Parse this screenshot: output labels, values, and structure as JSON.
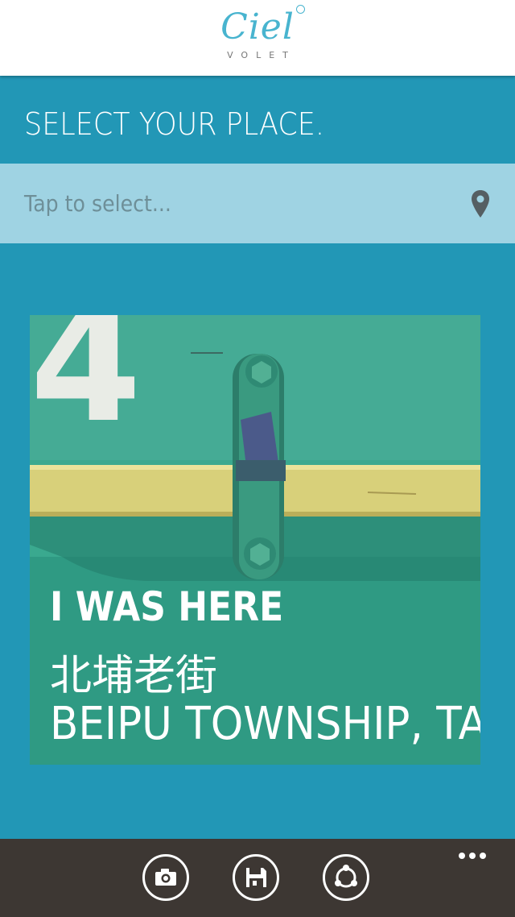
{
  "app": {
    "logo_script": "Ciel",
    "logo_sub": "VOLET"
  },
  "screen": {
    "title": "SELECT YOUR PLACE."
  },
  "place_picker": {
    "placeholder": "Tap to select...",
    "icon": "map-pin-icon"
  },
  "photo_card": {
    "line1": "I WAS HERE",
    "line2": "北埔老街",
    "line3": "BEIPU TOWNSHIP, TA",
    "painted_number": "4"
  },
  "app_bar": {
    "buttons": [
      {
        "icon": "camera-icon"
      },
      {
        "icon": "save-icon"
      },
      {
        "icon": "share-icon"
      }
    ],
    "more": "more-dots-icon"
  },
  "colors": {
    "background": "#2297b6",
    "header": "#ffffff",
    "picker": "#9fd3e3",
    "app_bar": "#3d3733",
    "logo": "#48b4cf"
  }
}
